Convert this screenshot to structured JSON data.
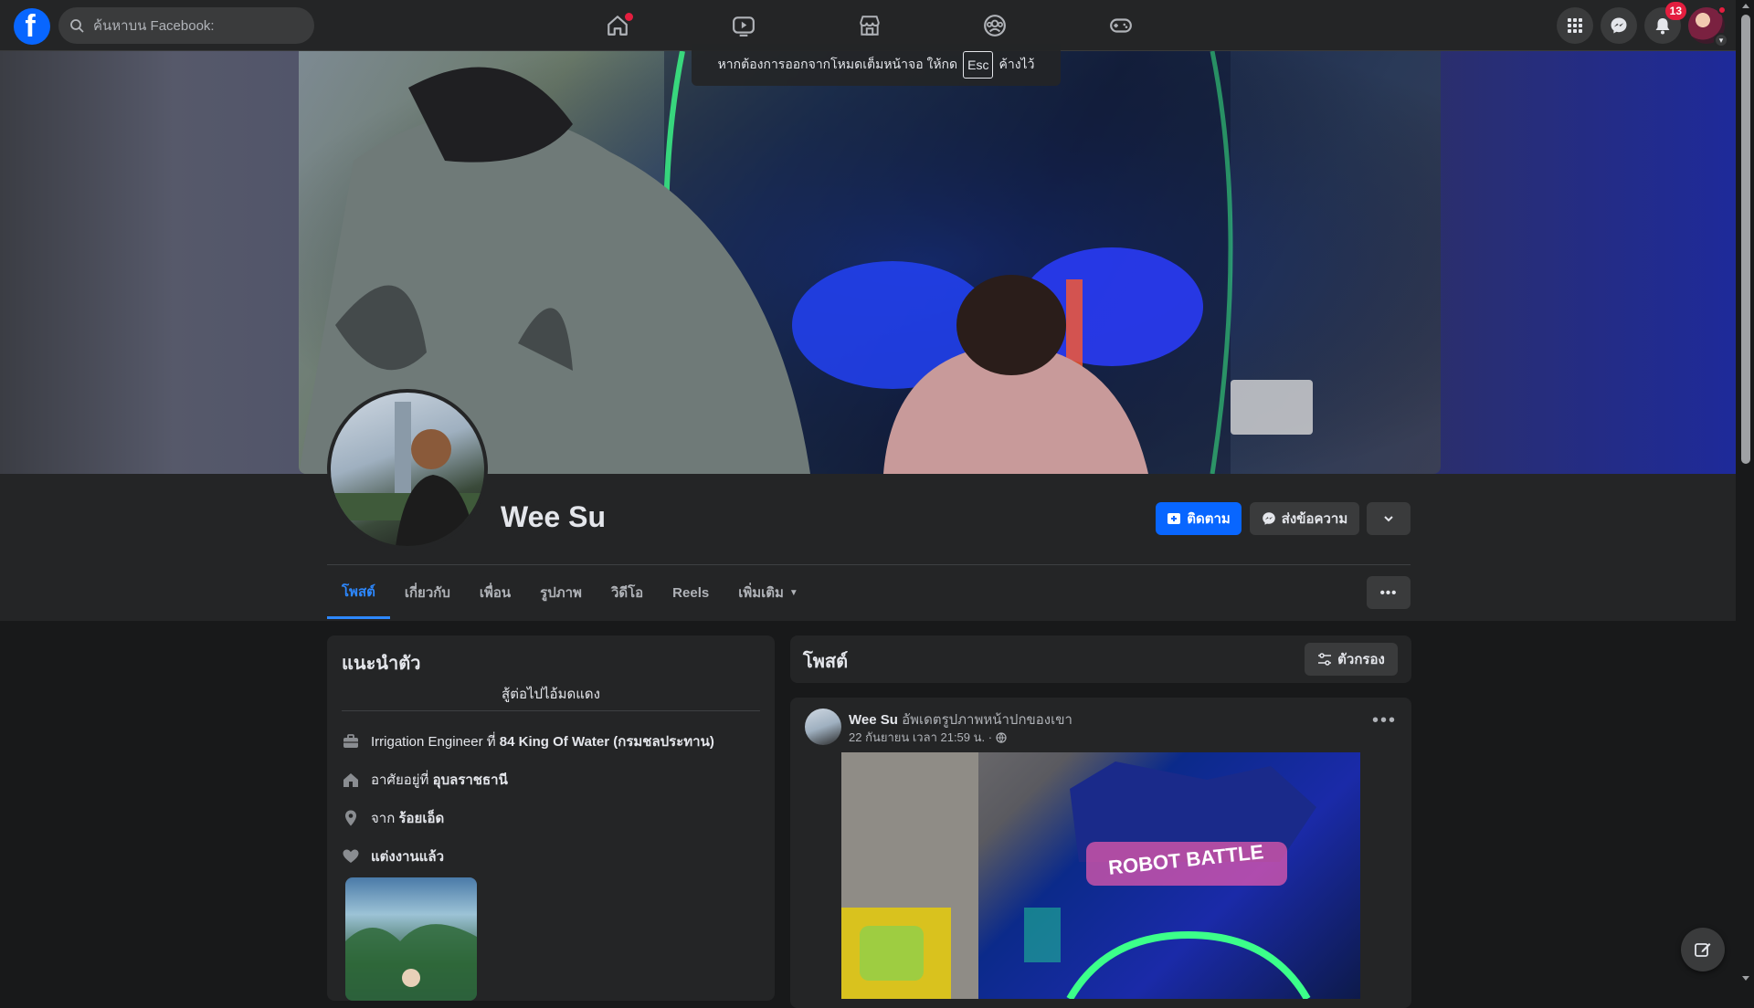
{
  "topbar": {
    "logo_letter": "f",
    "search_placeholder": "ค้นหาบน Facebook:",
    "nav": [
      "home-icon",
      "watch-icon",
      "marketplace-icon",
      "groups-icon",
      "gaming-icon"
    ],
    "notification_count": "13",
    "brand_color": "#0866ff"
  },
  "fullscreen_tip": {
    "before": "หากต้องการออกจากโหมดเต็มหน้าจอ ให้กด",
    "key": "Esc",
    "after": "ค้างไว้"
  },
  "profile": {
    "name": "Wee Su",
    "follow_label": "ติดตาม",
    "message_label": "ส่งข้อความ"
  },
  "tabs": [
    {
      "label": "โพสต์",
      "active": true
    },
    {
      "label": "เกี่ยวกับ"
    },
    {
      "label": "เพื่อน"
    },
    {
      "label": "รูปภาพ"
    },
    {
      "label": "วิดีโอ"
    },
    {
      "label": "Reels"
    },
    {
      "label": "เพิ่มเติม"
    }
  ],
  "intro": {
    "title": "แนะนำตัว",
    "bio": "สู้ต่อไปไอ้มดแดง",
    "work_prefix": "Irrigation Engineer ที่ ",
    "work_place": "84 King Of Water (กรมชลประทาน)",
    "lives_prefix": "อาศัยอยู่ที่ ",
    "lives_place": "อุบลราชธานี",
    "from_prefix": "จาก ",
    "from_place": "ร้อยเอ็ด",
    "relationship": "แต่งงานแล้ว"
  },
  "posts": {
    "title": "โพสต์",
    "filter_label": "ตัวกรอง"
  },
  "post": {
    "author": "Wee Su",
    "action": " อัพเดตรูปภาพหน้าปกของเขา",
    "date": "22 กันยายน เวลา 21:59 น. ·",
    "image_text": "ROBOT BATTLE"
  }
}
